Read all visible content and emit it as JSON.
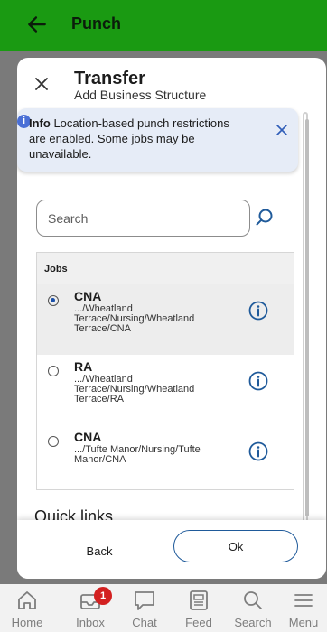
{
  "appbar": {
    "title": "Punch"
  },
  "modal": {
    "title": "Transfer",
    "subtitle": "Add Business Structure",
    "banner": {
      "bold": "Info",
      "message": "Location-based punch restrictions are enabled. Some jobs may be unavailable."
    },
    "search": {
      "placeholder": "Search"
    },
    "jobs": {
      "header": "Jobs",
      "items": [
        {
          "name": "CNA",
          "path": ".../Wheatland Terrace/Nursing/Wheatland Terrace/CNA",
          "selected": true
        },
        {
          "name": "RA",
          "path": ".../Wheatland Terrace/Nursing/Wheatland Terrace/RA",
          "selected": false
        },
        {
          "name": "CNA",
          "path": ".../Tufte Manor/Nursing/Tufte Manor/CNA",
          "selected": false
        }
      ]
    },
    "quick_links": "Quick links",
    "footer": {
      "back": "Back",
      "ok": "Ok"
    }
  },
  "bottomnav": {
    "items": [
      {
        "label": "Home",
        "icon": "home-icon"
      },
      {
        "label": "Inbox",
        "icon": "inbox-icon",
        "badge": "1"
      },
      {
        "label": "Chat",
        "icon": "chat-icon"
      },
      {
        "label": "Feed",
        "icon": "feed-icon"
      },
      {
        "label": "Search",
        "icon": "search-icon"
      },
      {
        "label": "Menu",
        "icon": "menu-icon"
      }
    ]
  },
  "colors": {
    "appbar": "#1a9a12",
    "accent": "#1f5a9a",
    "badge": "#d32020"
  }
}
